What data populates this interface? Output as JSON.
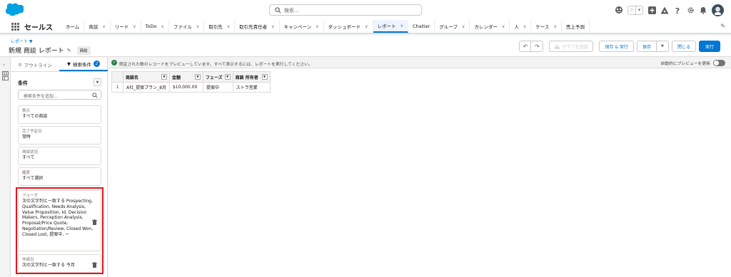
{
  "global_header": {
    "search_placeholder": "検索...",
    "icons": [
      "einstein-icon",
      "favorites-star-icon",
      "favorites-list-icon",
      "global-actions-add-icon",
      "trailhead-icon",
      "help-icon",
      "setup-gear-icon",
      "notifications-bell-icon",
      "user-avatar"
    ]
  },
  "nav": {
    "app_name": "セールス",
    "items": [
      {
        "label": "ホーム",
        "chevron": false,
        "active": false
      },
      {
        "label": "商談",
        "chevron": true,
        "active": false
      },
      {
        "label": "リード",
        "chevron": true,
        "active": false
      },
      {
        "label": "ToDo",
        "chevron": true,
        "active": false
      },
      {
        "label": "ファイル",
        "chevron": true,
        "active": false
      },
      {
        "label": "取引先",
        "chevron": true,
        "active": false
      },
      {
        "label": "取引先責任者",
        "chevron": true,
        "active": false
      },
      {
        "label": "キャンペーン",
        "chevron": true,
        "active": false
      },
      {
        "label": "ダッシュボード",
        "chevron": true,
        "active": false
      },
      {
        "label": "レポート",
        "chevron": true,
        "active": true
      },
      {
        "label": "Chatter",
        "chevron": false,
        "active": false
      },
      {
        "label": "グループ",
        "chevron": true,
        "active": false
      },
      {
        "label": "カレンダー",
        "chevron": true,
        "active": false
      },
      {
        "label": "人",
        "chevron": true,
        "active": false
      },
      {
        "label": "ケース",
        "chevron": true,
        "active": false
      },
      {
        "label": "売上予測",
        "chevron": false,
        "active": false
      }
    ]
  },
  "page_header": {
    "breadcrumb": "レポート ▼",
    "title": "新規 商談 レポート",
    "object_badge": "商談",
    "buttons": {
      "undo": "↶",
      "redo": "↷",
      "add_chart": "グラフを追加",
      "save_and_run": "保存 & 実行",
      "save": "保存",
      "save_dropdown": "▼",
      "close": "閉じる",
      "run": "実行"
    }
  },
  "filter_panel": {
    "tabs": {
      "outline": "アウトライン",
      "filters": "検索条件",
      "filter_count": "2"
    },
    "conditions_title": "条件",
    "search_placeholder": "検索条件を追加...",
    "filters": [
      {
        "label": "表示",
        "value": "すべての商談"
      },
      {
        "label": "完了予定日",
        "value": "常時"
      },
      {
        "label": "商談状況",
        "value": "すべて"
      },
      {
        "label": "確度",
        "value": "すべて選択"
      },
      {
        "label": "フェーズ",
        "value": "次の文字列と一致する Prospecting, Qualification, Needs Analysis, Value Proposition, Id. Decision Makers, Perception Analysis, Proposal/Price Quote, Negotiation/Review, Closed Won, Closed Lost, 提案中, ー"
      },
      {
        "label": "作成日",
        "value": "次の文字列と一致する 今月"
      }
    ]
  },
  "preview": {
    "notice": "限定された数のレコードをプレビューしています。すべて表示するには、レポートを実行してください。",
    "auto_preview_label": "自動的にプレビューを更新",
    "columns": [
      "商談名",
      "金額",
      "フェーズ",
      "商談 所有者"
    ],
    "rows": [
      {
        "num": "1",
        "cells": [
          "A社_提案プラン_8月",
          "$10,000.00",
          "提案中",
          "ストラ営業"
        ]
      }
    ]
  },
  "colors": {
    "brand_blue": "#0176d3",
    "highlight_red": "#e4151b",
    "success_green": "#2e844a",
    "salesforce_cloud": "#00a1e0"
  }
}
